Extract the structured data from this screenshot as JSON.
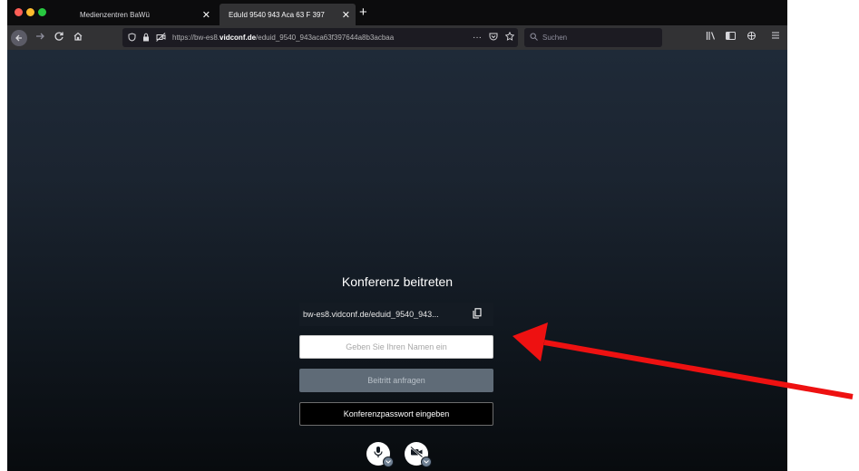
{
  "browser": {
    "tabs": [
      {
        "title": "Medienzentren BaWü",
        "close": "✕"
      },
      {
        "title": "EduId 9540 943 Aca 63 F 397",
        "close": "✕"
      }
    ],
    "new_tab": "+",
    "url": {
      "prefix": "https://bw-es8.",
      "host": "vidconf.de",
      "path": "/eduid_9540_943aca63f397644a8b3acbaa",
      "more": "···"
    },
    "search_placeholder": "Suchen"
  },
  "conference": {
    "title": "Konferenz beitreten",
    "room_url": "bw-es8.vidconf.de/eduid_9540_943...",
    "name_placeholder": "Geben Sie Ihren Namen ein",
    "join_label": "Beitritt anfragen",
    "password_label": "Konferenzpasswort eingeben"
  },
  "colors": {
    "annotation_arrow": "#ee1111",
    "join_button": "#5f6b77"
  },
  "icons": {
    "back": "back-arrow-icon",
    "forward": "forward-arrow-icon",
    "reload": "reload-icon",
    "home": "home-icon",
    "copy": "copy-icon",
    "mic": "microphone-icon",
    "camera": "camera-off-icon"
  }
}
